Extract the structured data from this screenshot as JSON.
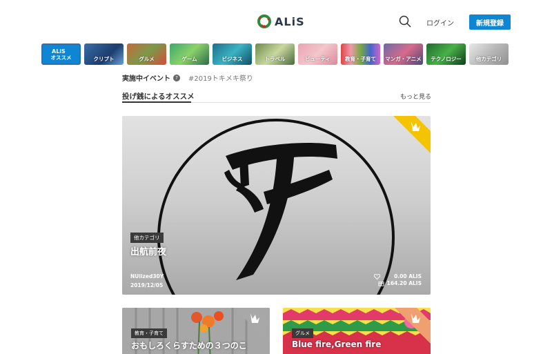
{
  "header": {
    "logo_text": "ALiS",
    "login_label": "ログイン",
    "signup_label": "新規登録"
  },
  "categories": [
    {
      "label": "オススメ",
      "logo": "ALiS",
      "selected": true
    },
    {
      "label": "クリプト"
    },
    {
      "label": "グルメ"
    },
    {
      "label": "ゲーム"
    },
    {
      "label": "ビジネス"
    },
    {
      "label": "トラベル"
    },
    {
      "label": "ビューティ"
    },
    {
      "label": "教育・子育て"
    },
    {
      "label": "マンガ・アニメ"
    },
    {
      "label": "テクノロジー"
    },
    {
      "label": "他カテゴリ"
    }
  ],
  "event": {
    "title": "実施中イベント",
    "help": "?",
    "tag": "#2019トキメキ祭り"
  },
  "section": {
    "title": "投げ銭によるオススメ",
    "see_more": "もっと見る"
  },
  "feature": {
    "category": "他カテゴリ",
    "title": "出航前夜",
    "author": "NUlized30Y",
    "date": "2019/12/05",
    "likes": "0.00 ALIS",
    "tips": "164.20 ALIS"
  },
  "cards": [
    {
      "category": "教育・子育て",
      "title": "おもしろくらすための３つのこ"
    },
    {
      "category": "グルメ",
      "title": "Blue fire,Green fire"
    }
  ],
  "colors": {
    "accent": "#0e86d4",
    "gold_ribbon": "#f5c400",
    "silver_ribbon": "#a8a8a8",
    "bronze_ribbon": "#f0a070"
  }
}
